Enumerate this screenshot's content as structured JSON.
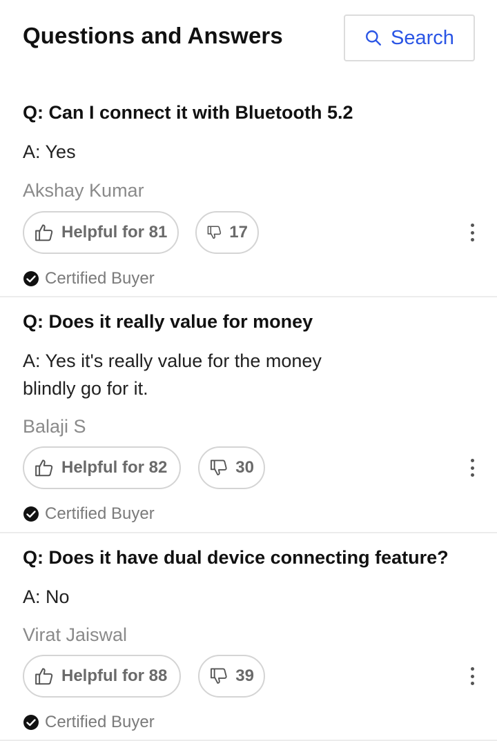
{
  "header": {
    "title": "Questions and Answers",
    "search_label": "Search"
  },
  "qa": [
    {
      "question": "Q: Can I connect it with Bluetooth 5.2",
      "answer_line1": "A: Yes",
      "answer_line2": "",
      "author": "Akshay Kumar",
      "helpful_label": "Helpful for 81",
      "dislike_count": "17",
      "certified": "Certified Buyer"
    },
    {
      "question": "Q: Does it really value for money",
      "answer_line1": "A: Yes it's really value for the money",
      "answer_line2": "blindly go for it.",
      "author": "Balaji S",
      "helpful_label": "Helpful for 82",
      "dislike_count": "30",
      "certified": "Certified Buyer"
    },
    {
      "question": "Q: Does it have dual device connecting feature?",
      "answer_line1": "A: No",
      "answer_line2": "",
      "author": "Virat Jaiswal",
      "helpful_label": "Helpful for 88",
      "dislike_count": "39",
      "certified": "Certified Buyer"
    }
  ],
  "colors": {
    "accent": "#2a55e5",
    "text_primary": "#111111",
    "text_muted": "#8a8a8a",
    "border": "#d4d4d4"
  },
  "icons": {
    "search": "search-icon",
    "thumbs_up": "thumbs-up-icon",
    "thumbs_down": "thumbs-down-icon",
    "more": "more-vertical-icon",
    "certified": "check-circle-icon"
  }
}
